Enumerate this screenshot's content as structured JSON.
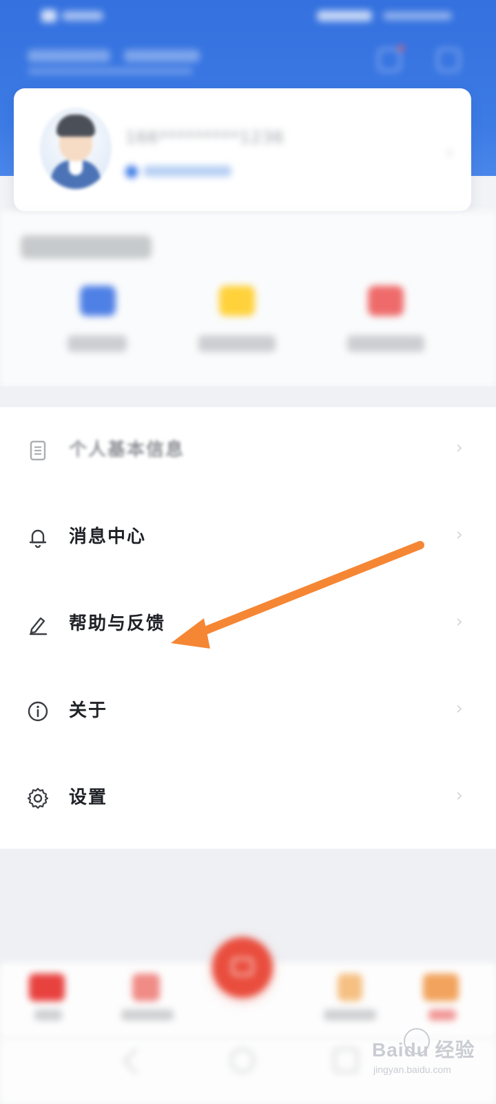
{
  "profile": {
    "masked_phone": "166*********1236"
  },
  "menu": {
    "items": [
      {
        "label": "个人基本信息",
        "icon": "document-icon"
      },
      {
        "label": "消息中心",
        "icon": "bell-icon"
      },
      {
        "label": "帮助与反馈",
        "icon": "pencil-icon"
      },
      {
        "label": "关于",
        "icon": "info-icon"
      },
      {
        "label": "设置",
        "icon": "gear-icon"
      }
    ],
    "chevron": "›"
  },
  "watermark": {
    "brand": "Baidu 经验",
    "url": "jingyan.baidu.com"
  },
  "colors": {
    "header_blue": "#3571df",
    "annotation_orange": "#f58634",
    "center_button_red": "#e94d3d"
  }
}
